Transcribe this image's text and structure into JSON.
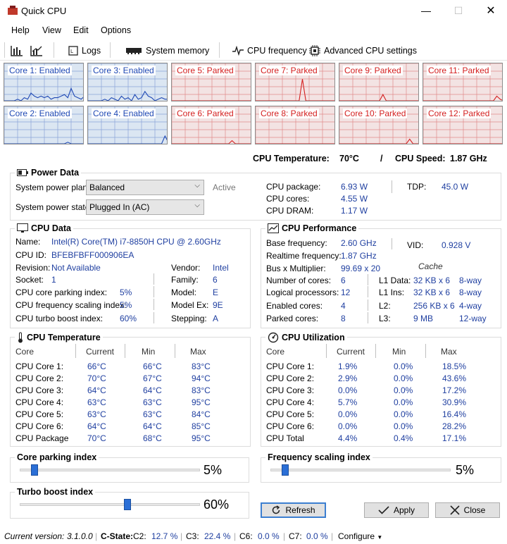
{
  "window": {
    "title": "Quick CPU"
  },
  "menu": [
    "Help",
    "View",
    "Edit",
    "Options"
  ],
  "toolbar": {
    "logs": "Logs",
    "system_memory": "System memory",
    "cpu_frequency": "CPU frequency",
    "advanced": "Advanced CPU settings"
  },
  "cores": [
    {
      "label": "Core 1: Enabled",
      "state": "enabled"
    },
    {
      "label": "Core 3: Enabled",
      "state": "enabled"
    },
    {
      "label": "Core 5: Parked",
      "state": "parked"
    },
    {
      "label": "Core 7: Parked",
      "state": "parked"
    },
    {
      "label": "Core 9: Parked",
      "state": "parked"
    },
    {
      "label": "Core 11: Parked",
      "state": "parked"
    },
    {
      "label": "Core 2: Enabled",
      "state": "enabled"
    },
    {
      "label": "Core 4: Enabled",
      "state": "enabled"
    },
    {
      "label": "Core 6: Parked",
      "state": "parked"
    },
    {
      "label": "Core 8: Parked",
      "state": "parked"
    },
    {
      "label": "Core 10: Parked",
      "state": "parked"
    },
    {
      "label": "Core 12: Parked",
      "state": "parked"
    }
  ],
  "summary": {
    "temp_label": "CPU Temperature:",
    "temp_value": "70°C",
    "slash": "/",
    "speed_label": "CPU Speed:",
    "speed_value": "1.87 GHz"
  },
  "power": {
    "title": "Power Data",
    "plan_label": "System power plan:",
    "plan_value": "Balanced",
    "plan_status": "Active",
    "state_label": "System power state:",
    "state_value": "Plugged In (AC)",
    "package_label": "CPU package:",
    "package_value": "6.93 W",
    "cores_label": "CPU cores:",
    "cores_value": "4.55 W",
    "dram_label": "CPU DRAM:",
    "dram_value": "1.17 W",
    "tdp_label": "TDP:",
    "tdp_value": "45.0 W"
  },
  "cpu_data": {
    "title": "CPU Data",
    "name_label": "Name:",
    "name_value": "Intel(R) Core(TM) i7-8850H CPU @ 2.60GHz",
    "id_label": "CPU ID:",
    "id_value": "BFEBFBFF000906EA",
    "revision_label": "Revision:",
    "revision_value": "Not Available",
    "vendor_label": "Vendor:",
    "vendor_value": "Intel",
    "socket_label": "Socket:",
    "socket_value": "1",
    "family_label": "Family:",
    "family_value": "6",
    "parking_label": "CPU core parking index:",
    "parking_value": "5%",
    "model_label": "Model:",
    "model_value": "E",
    "freq_label": "CPU frequency scaling index:",
    "freq_value": "5%",
    "modelex_label": "Model Ex:",
    "modelex_value": "9E",
    "turbo_label": "CPU turbo boost index:",
    "turbo_value": "60%",
    "stepping_label": "Stepping:",
    "stepping_value": "A"
  },
  "cpu_perf": {
    "title": "CPU Performance",
    "base_label": "Base frequency:",
    "base_value": "2.60 GHz",
    "vid_label": "VID:",
    "vid_value": "0.928 V",
    "rt_label": "Realtime frequency:",
    "rt_value": "1.87 GHz",
    "cache_header": "Cache",
    "bus_label": "Bus x Multiplier:",
    "bus_value": "99.69 x 20",
    "ncores_label": "Number of cores:",
    "ncores_value": "6",
    "l1d_label": "L1 Data:",
    "l1d_value": "32 KB x 6",
    "l1d_way": "8-way",
    "lp_label": "Logical processors:",
    "lp_value": "12",
    "l1i_label": "L1 Ins:",
    "l1i_value": "32 KB x 6",
    "l1i_way": "8-way",
    "en_label": "Enabled cores:",
    "en_value": "4",
    "l2_label": "L2:",
    "l2_value": "256 KB x 6",
    "l2_way": "4-way",
    "pk_label": "Parked cores:",
    "pk_value": "8",
    "l3_label": "L3:",
    "l3_value": "9 MB",
    "l3_way": "12-way"
  },
  "cpu_temp": {
    "title": "CPU Temperature",
    "headers": [
      "Core",
      "Current",
      "Min",
      "Max"
    ],
    "rows": [
      [
        "CPU Core 1:",
        "66°C",
        "66°C",
        "83°C"
      ],
      [
        "CPU Core 2:",
        "70°C",
        "67°C",
        "94°C"
      ],
      [
        "CPU Core 3:",
        "64°C",
        "64°C",
        "83°C"
      ],
      [
        "CPU Core 4:",
        "63°C",
        "63°C",
        "95°C"
      ],
      [
        "CPU Core 5:",
        "63°C",
        "63°C",
        "84°C"
      ],
      [
        "CPU Core 6:",
        "64°C",
        "64°C",
        "85°C"
      ],
      [
        "CPU Package",
        "70°C",
        "68°C",
        "95°C"
      ]
    ]
  },
  "cpu_util": {
    "title": "CPU Utilization",
    "headers": [
      "Core",
      "Current",
      "Min",
      "Max"
    ],
    "rows": [
      [
        "CPU Core 1:",
        "1.9%",
        "0.0%",
        "18.5%"
      ],
      [
        "CPU Core 2:",
        "2.9%",
        "0.0%",
        "43.6%"
      ],
      [
        "CPU Core 3:",
        "0.0%",
        "0.0%",
        "17.2%"
      ],
      [
        "CPU Core 4:",
        "5.7%",
        "0.0%",
        "30.9%"
      ],
      [
        "CPU Core 5:",
        "0.0%",
        "0.0%",
        "16.4%"
      ],
      [
        "CPU Core 6:",
        "0.0%",
        "0.0%",
        "28.2%"
      ],
      [
        "CPU Total",
        "4.4%",
        "0.4%",
        "17.1%"
      ]
    ]
  },
  "sliders": {
    "parking_label": "Core parking index",
    "parking_value": "5%",
    "parking_level": 0.05,
    "freq_label": "Frequency scaling index",
    "freq_value": "5%",
    "freq_level": 0.05,
    "turbo_label": "Turbo boost index",
    "turbo_value": "60%",
    "turbo_level": 0.6
  },
  "buttons": {
    "refresh": "Refresh",
    "apply": "Apply",
    "close": "Close"
  },
  "status": {
    "version_label": "Current version:",
    "version_value": "3.1.0.0",
    "cstate_label": "C-State:",
    "c2_label": "C2:",
    "c2_value": "12.7 %",
    "c3_label": "C3:",
    "c3_value": "22.4 %",
    "c6_label": "C6:",
    "c6_value": "0.0 %",
    "c7_label": "C7:",
    "c7_value": "0.0 %",
    "configure": "Configure"
  },
  "colors": {
    "enabled": "#1f49b4",
    "parked": "#d42020",
    "value": "#1f3fa0"
  }
}
